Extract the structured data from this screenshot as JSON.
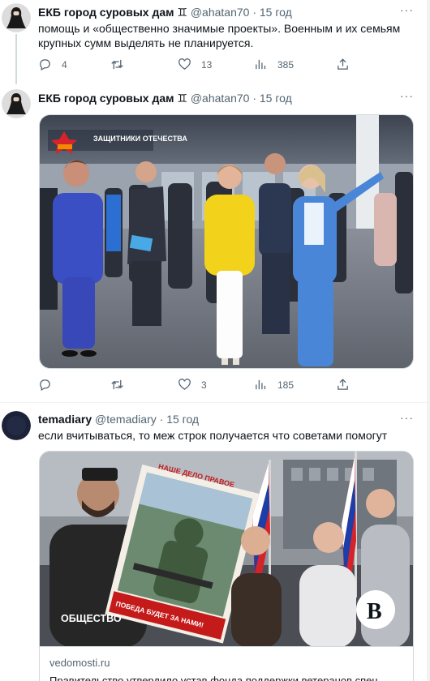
{
  "tweets": [
    {
      "name": "ЕКБ город суровых дам ♊",
      "handle": "@ahatan70",
      "sep": "·",
      "time": "15 год",
      "more": "···",
      "text": "помощь и «общественно значимые проекты». Военным и их семьям крупных сумм выделять не планируется.",
      "replies": "4",
      "retweets": "",
      "likes": "13",
      "views": "385"
    },
    {
      "name": "ЕКБ город суровых дам ♊",
      "handle": "@ahatan70",
      "sep": "·",
      "time": "15 год",
      "more": "···",
      "replies": "",
      "retweets": "",
      "likes": "3",
      "views": "185",
      "photo_banner": "ЗАЩИТНИКИ ОТЕЧЕСТВА"
    },
    {
      "name": "temadiary",
      "handle": "@temadiary",
      "sep": "·",
      "time": "15 год",
      "more": "···",
      "text": "если вчитываться, то меж строк получается что советами помогут",
      "card": {
        "section_label": "ОБЩЕСТВО",
        "brand_letter": "В",
        "poster_top": "НАШЕ ДЕЛО ПРАВОЕ",
        "poster_bottom": "ПОБЕДА БУДЕТ ЗА НАМИ!",
        "domain": "vedomosti.ru",
        "title": "Правительство утвердило устав фонда поддержки ветеранов спец"
      }
    }
  ],
  "icons": [
    "reply-icon",
    "retweet-icon",
    "like-icon",
    "views-icon",
    "share-icon",
    "more-icon"
  ],
  "colors": {
    "text_primary": "#0f1419",
    "text_secondary": "#536471",
    "border": "#cfd9de",
    "suit_blue": "#3b4fc4",
    "suit_yellow": "#f2d21a"
  }
}
